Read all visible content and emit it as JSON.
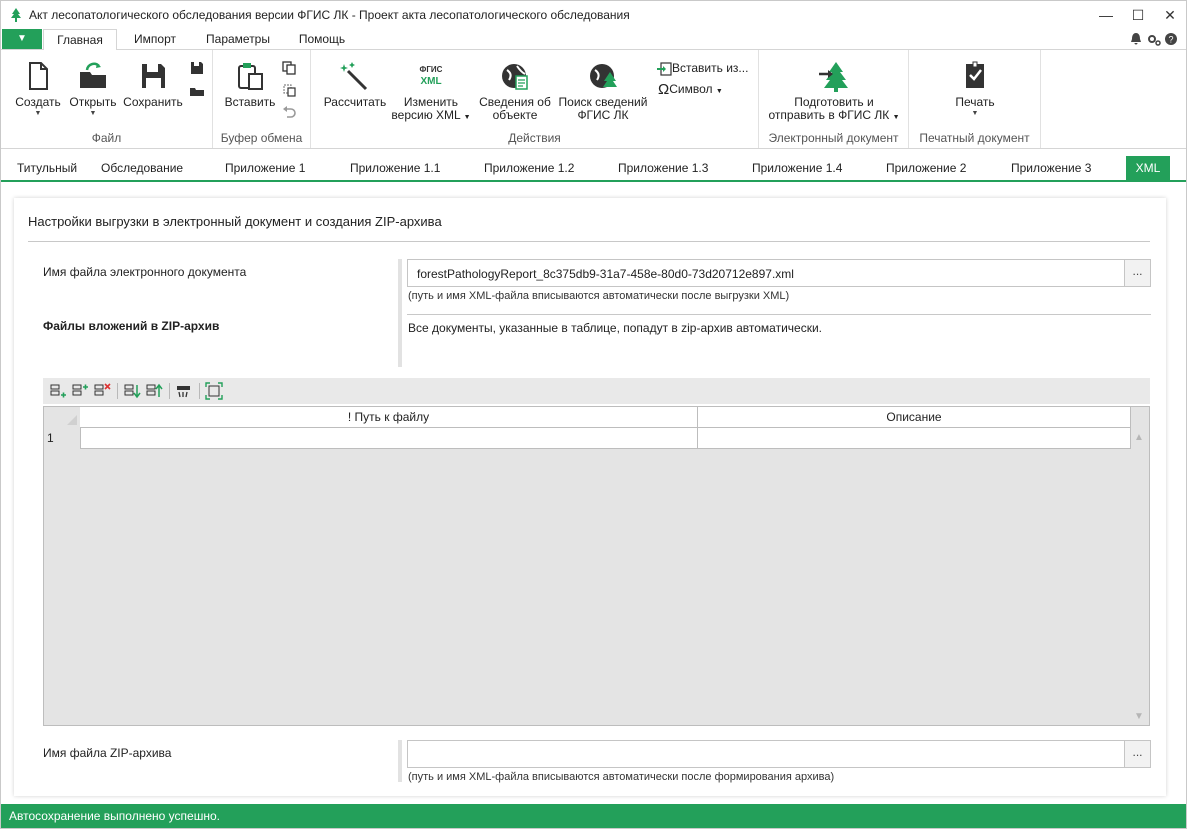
{
  "window": {
    "title": "Акт лесопатологического обследования версии ФГИС ЛК - Проект акта лесопатологического обследования",
    "minimize": "—",
    "maximize": "☐",
    "close": "✕"
  },
  "menu": {
    "file_arrow": "▼",
    "tabs": [
      "Главная",
      "Импорт",
      "Параметры",
      "Помощь"
    ],
    "active_tab": "Главная"
  },
  "ribbon": {
    "file_group": {
      "label": "Файл",
      "create": "Создать",
      "open": "Открыть",
      "save": "Сохранить"
    },
    "clipboard_group": {
      "label": "Буфер обмена",
      "paste": "Вставить"
    },
    "actions_group": {
      "label": "Действия",
      "calculate": "Рассчитать",
      "change_xml_line1": "Изменить",
      "change_xml_line2": "версию XML",
      "xml_icon_top": "ФГИС",
      "xml_icon_bottom": "XML",
      "object_info_line1": "Сведения об",
      "object_info_line2": "объекте",
      "search_line1": "Поиск сведений",
      "search_line2": "ФГИС ЛК",
      "insert_from": "Вставить из...",
      "symbol": "Символ"
    },
    "edoc_group": {
      "label": "Электронный документ",
      "prepare_line1": "Подготовить и",
      "prepare_line2": "отправить в ФГИС ЛК"
    },
    "print_group": {
      "label": "Печатный документ",
      "print": "Печать"
    }
  },
  "doc_tabs": [
    "Титульный",
    "Обследование",
    "Приложение 1",
    "Приложение 1.1",
    "Приложение 1.2",
    "Приложение 1.3",
    "Приложение 1.4",
    "Приложение 2",
    "Приложение 3",
    "XML"
  ],
  "active_doc_tab": "XML",
  "panel": {
    "title": "Настройки выгрузки в электронный документ и создания ZIP-архива",
    "edoc_filename_label": "Имя файла электронного документа",
    "edoc_filename_value": "forestPathologyReport_8c375db9-31a7-458e-80d0-73d20712e897.xml",
    "edoc_filename_hint": "(путь и имя XML-файла вписываются автоматически после выгрузки XML)",
    "attachments_label": "Файлы вложений в ZIP-архив",
    "attachments_info": "Все документы, указанные в таблице, попадут в zip-архив автоматически.",
    "browse": "...",
    "grid": {
      "columns": [
        "! Путь к файлу",
        "Описание"
      ],
      "rows": [
        {
          "num": "1",
          "path": "",
          "description": ""
        }
      ]
    },
    "zip_filename_label": "Имя файла ZIP-архива",
    "zip_filename_value": "",
    "zip_filename_hint": "(путь и имя XML-файла вписываются автоматически после формирования архива)"
  },
  "status": {
    "text": "Автосохранение выполнено успешно."
  },
  "colors": {
    "accent": "#23a05a",
    "status_bar": "#23a05a"
  }
}
